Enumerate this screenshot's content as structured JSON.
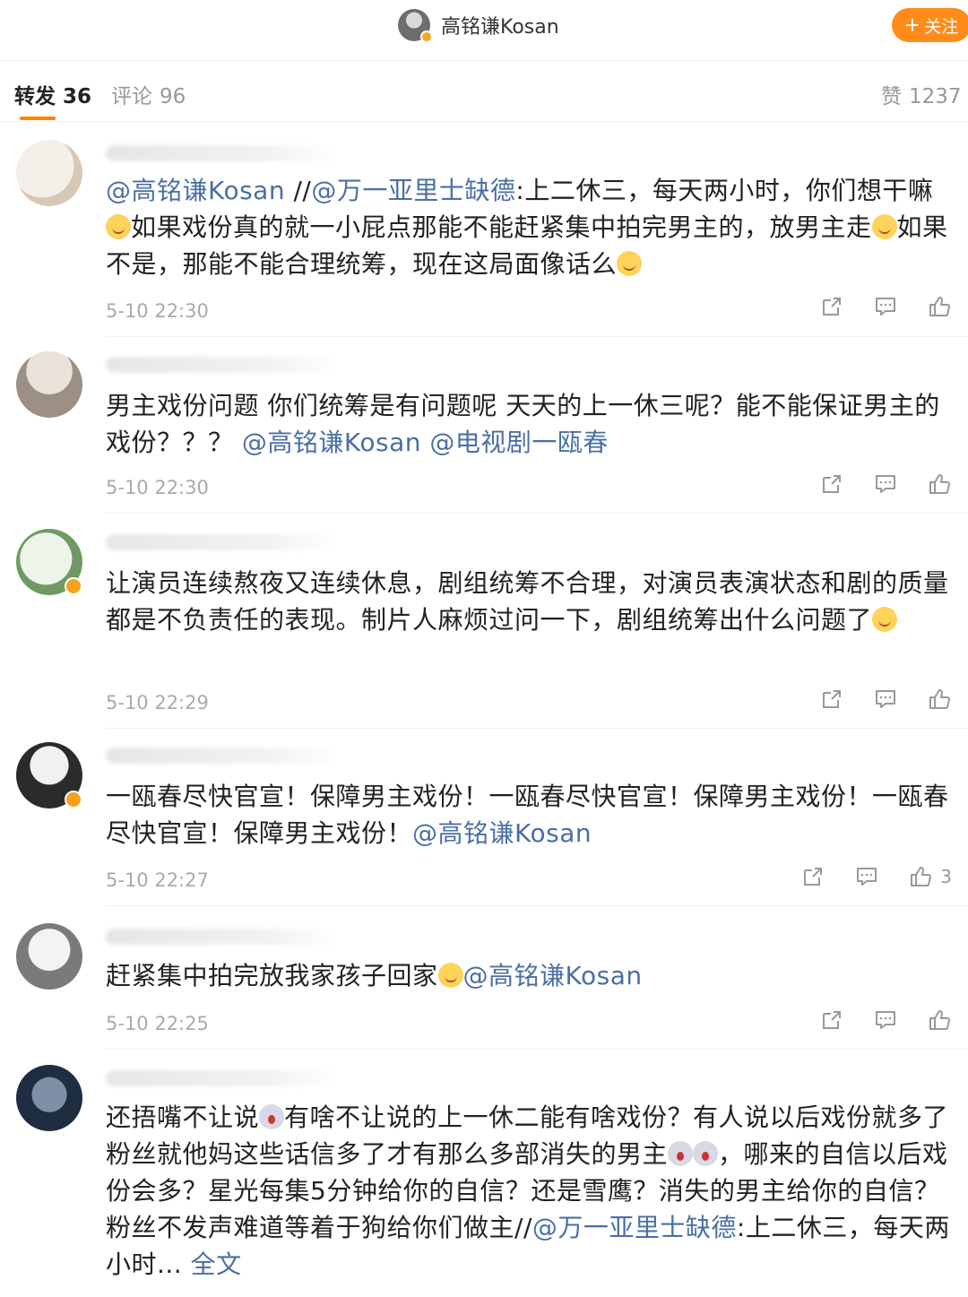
{
  "header": {
    "author_name": "高铭谦Kosan",
    "follow_label": "关注",
    "follow_plus": "+"
  },
  "tabs": {
    "repost": {
      "label": "转发",
      "count": "36"
    },
    "comments": {
      "label": "评论",
      "count": "96"
    },
    "likes": {
      "label": "赞",
      "count": "1237"
    }
  },
  "comments": [
    {
      "time": "5-10 22:30",
      "segments": [
        {
          "text": "@高铭谦Kosan",
          "link": true
        },
        {
          "text": " //",
          "link": false
        },
        {
          "text": "@万一亚里士缺德",
          "link": true
        },
        {
          "text": ":上二休三，每天两小时，你们想干嘛",
          "link": false
        },
        {
          "emoji": "smile"
        },
        {
          "text": "如果戏份真的就一小屁点那能不能赶紧集中拍完男主的，放男主走",
          "link": false
        },
        {
          "emoji": "smile"
        },
        {
          "text": "如果不是，那能不能合理统筹，现在这局面像话么",
          "link": false
        },
        {
          "emoji": "smile"
        }
      ],
      "like_count": ""
    },
    {
      "time": "5-10 22:30",
      "segments": [
        {
          "text": "男主戏份问题 你们统筹是有问题呢 天天的上一休三呢？能不能保证男主的戏份？？？ ",
          "link": false
        },
        {
          "text": "@高铭谦Kosan",
          "link": true
        },
        {
          "text": " ",
          "link": false
        },
        {
          "text": "@电视剧一瓯春",
          "link": true
        }
      ],
      "like_count": ""
    },
    {
      "time": "5-10 22:29",
      "segments": [
        {
          "text": "让演员连续熬夜又连续休息，剧组统筹不合理，对演员表演状态和剧的质量都是不负责任的表现。制片人麻烦过问一下，剧组统筹出什么问题了",
          "link": false
        },
        {
          "emoji": "smile"
        }
      ],
      "like_count": ""
    },
    {
      "time": "5-10 22:27",
      "segments": [
        {
          "text": "一瓯春尽快官宣！保障男主戏份！一瓯春尽快官宣！保障男主戏份！一瓯春尽快官宣！保障男主戏份！",
          "link": false
        },
        {
          "text": "@高铭谦Kosan",
          "link": true
        }
      ],
      "like_count": "3"
    },
    {
      "time": "5-10 22:25",
      "segments": [
        {
          "text": "赶紧集中拍完放我家孩子回家",
          "link": false
        },
        {
          "emoji": "smile"
        },
        {
          "text": "@高铭谦Kosan",
          "link": true
        }
      ],
      "like_count": ""
    },
    {
      "time": "",
      "segments": [
        {
          "text": "还捂嘴不让说",
          "link": false
        },
        {
          "emoji": "wow"
        },
        {
          "text": "有啥不让说的上一休二能有啥戏份？有人说以后戏份就多了 粉丝就他妈这些话信多了才有那么多部消失的男主",
          "link": false
        },
        {
          "emoji": "wow"
        },
        {
          "emoji": "wow"
        },
        {
          "text": "，哪来的自信以后戏份会多？星光每集5分钟给你的自信？还是雪鹰？消失的男主给你的自信？粉丝不发声难道等着于狗给你们做主",
          "link": false
        },
        {
          "text": "//",
          "link": false
        },
        {
          "text": "@万一亚里士缺德",
          "link": true
        },
        {
          "text": ":上二休三，每天两小时... ",
          "link": false
        },
        {
          "text": "全文",
          "link": true
        }
      ],
      "like_count": ""
    }
  ],
  "icons": {
    "share": "share-icon",
    "comment": "comment-icon",
    "like": "thumbs-up-icon"
  },
  "colors": {
    "accent": "#ff8200",
    "link": "#4a6fa5",
    "follow_bg": "#ff8c1a"
  }
}
